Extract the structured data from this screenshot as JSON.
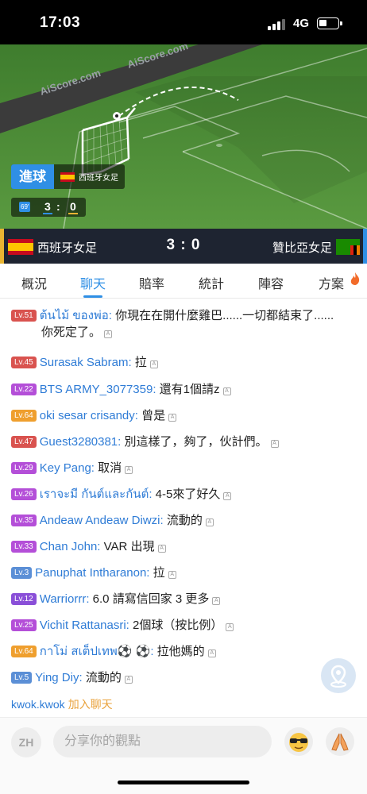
{
  "status": {
    "time": "17:03",
    "network": "4G"
  },
  "pitch": {
    "watermark": "AiScore.com",
    "goal_label": "進球",
    "goal_team": "西班牙女足",
    "minute": "69'",
    "home_score": "3",
    "colon": ":",
    "away_score": "0"
  },
  "match": {
    "home": "西班牙女足",
    "score": "3 : 0",
    "away": "贊比亞女足"
  },
  "tabs": [
    {
      "label": "概況"
    },
    {
      "label": "聊天"
    },
    {
      "label": "賠率"
    },
    {
      "label": "統計"
    },
    {
      "label": "陣容"
    },
    {
      "label": "方案"
    }
  ],
  "chat": [
    {
      "level": "Lv.51",
      "color": "#d9534f",
      "user": "ต้นไม้ ของพ่อ:",
      "text": "你現在在開什麼雞巴......一切都結束了......",
      "text2": "你死定了。"
    },
    {
      "level": "Lv.45",
      "color": "#d9534f",
      "user": "Surasak Sabram:",
      "text": "拉"
    },
    {
      "level": "Lv.22",
      "color": "#b44fd8",
      "user": "BTS ARMY_3077359:",
      "text": "還有1個請z"
    },
    {
      "level": "Lv.64",
      "color": "#ef9f2e",
      "user": "oki sesar crisandy:",
      "text": "曾是"
    },
    {
      "level": "Lv.47",
      "color": "#d9534f",
      "user": "Guest3280381:",
      "text": "別這樣了，夠了，伙計們。"
    },
    {
      "level": "Lv.29",
      "color": "#b44fd8",
      "user": "Key Pang:",
      "text": "取消"
    },
    {
      "level": "Lv.26",
      "color": "#b44fd8",
      "user": "เราจะมี กันต์และกันต์:",
      "text": "4-5來了好久"
    },
    {
      "level": "Lv.35",
      "color": "#b44fd8",
      "user": "Andeaw Andeaw Diwzi:",
      "text": "流動的"
    },
    {
      "level": "Lv.33",
      "color": "#b44fd8",
      "user": "Chan John:",
      "text": "VAR 出現"
    },
    {
      "level": "Lv.3",
      "color": "#5b8fd6",
      "user": "Panuphat Intharanon:",
      "text": "拉"
    },
    {
      "level": "Lv.12",
      "color": "#8a4fd8",
      "user": "Warriorrr:",
      "text": "6.0 請寫信回家 3 更多"
    },
    {
      "level": "Lv.25",
      "color": "#b44fd8",
      "user": "Vichit Rattanasri:",
      "text": "2個球（按比例）"
    },
    {
      "level": "Lv.64",
      "color": "#ef9f2e",
      "user": "กาโม่ สเต็ปเทพ⚽ ⚽:",
      "text": "拉他媽的"
    },
    {
      "level": "Lv.5",
      "color": "#5b8fd6",
      "user": "Ying Diy:",
      "text": "流動的"
    }
  ],
  "join": {
    "user": "kwok.kwok",
    "text": "加入聊天"
  },
  "input": {
    "lang": "ZH",
    "placeholder": "分享你的觀點"
  },
  "translate_mark": "A"
}
